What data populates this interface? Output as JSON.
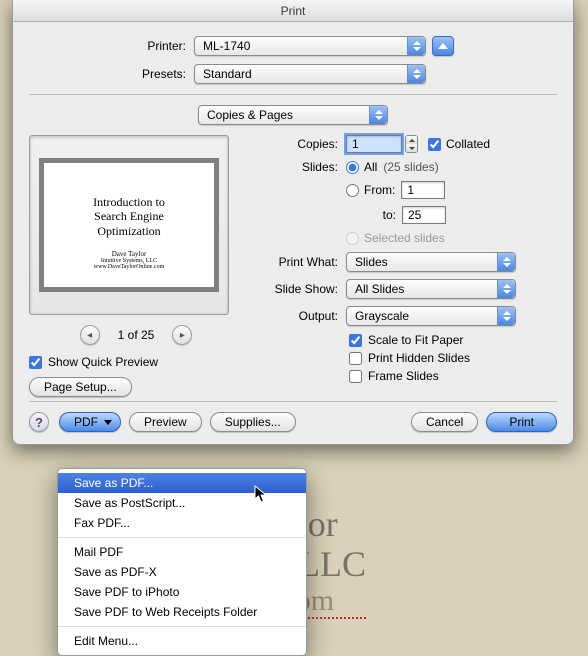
{
  "window": {
    "title": "Print"
  },
  "printer": {
    "label": "Printer:",
    "value": "ML-1740"
  },
  "presets": {
    "label": "Presets:",
    "value": "Standard"
  },
  "panel_select": "Copies & Pages",
  "copies": {
    "label": "Copies:",
    "value": "1",
    "collated_label": "Collated",
    "collated": true
  },
  "slides": {
    "label": "Slides:",
    "all_label": "All",
    "count_label": "(25 slides)",
    "from_label": "From:",
    "from_value": "1",
    "to_label": "to:",
    "to_value": "25",
    "selected_label": "Selected slides"
  },
  "print_what": {
    "label": "Print What:",
    "value": "Slides"
  },
  "slide_show": {
    "label": "Slide Show:",
    "value": "All Slides"
  },
  "output": {
    "label": "Output:",
    "value": "Grayscale"
  },
  "options": {
    "scale_label": "Scale to Fit Paper",
    "scale": true,
    "hidden_label": "Print Hidden Slides",
    "hidden": false,
    "frame_label": "Frame Slides",
    "frame": false
  },
  "preview": {
    "title_line1": "Introduction to",
    "title_line2": "Search Engine",
    "title_line3": "Optimization",
    "author": "Dave Taylor",
    "company": "Intuitive Systems, LLC",
    "url": "www.DaveTaylorOnline.com",
    "page_label": "1 of 25",
    "quick_label": "Show Quick Preview",
    "page_setup": "Page Setup..."
  },
  "buttons": {
    "pdf": "PDF",
    "preview": "Preview",
    "supplies": "Supplies...",
    "cancel": "Cancel",
    "print": "Print"
  },
  "pdf_menu": [
    "Save as PDF...",
    "Save as PostScript...",
    "Fax PDF...",
    "-",
    "Mail PDF",
    "Save as PDF-X",
    "Save PDF to iPhoto",
    "Save PDF to Web Receipts Folder",
    "-",
    "Edit Menu..."
  ],
  "bg": {
    "l1": "Dave Taylor",
    "l2": "Systems, LLC",
    "l3": "lorOnline.com"
  }
}
